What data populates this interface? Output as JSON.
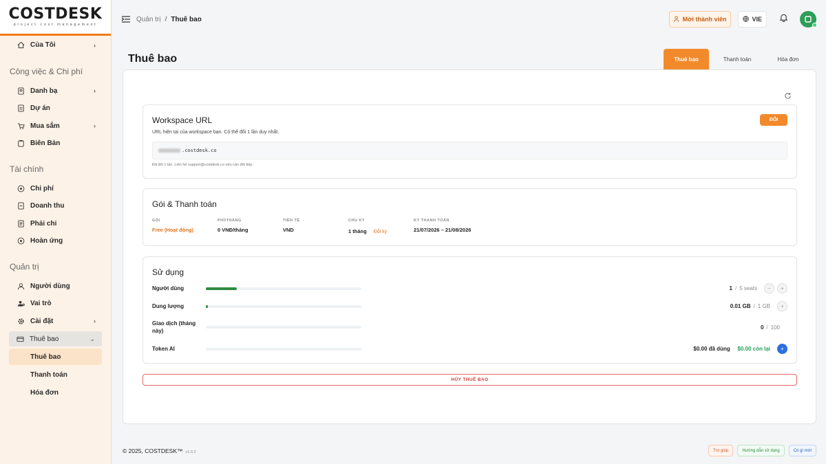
{
  "logo": {
    "name": "COSTDESK",
    "tagline": "project cost management"
  },
  "sidebar": {
    "top_item": {
      "label": "Của Tôi"
    },
    "sections": [
      {
        "title": "Công việc & Chi phí",
        "items": [
          {
            "label": "Danh bạ",
            "chevron": true
          },
          {
            "label": "Dự án",
            "chevron": false
          },
          {
            "label": "Mua sắm",
            "chevron": true
          },
          {
            "label": "Biên Bản",
            "chevron": false
          }
        ]
      },
      {
        "title": "Tài chính",
        "items": [
          {
            "label": "Chi phí"
          },
          {
            "label": "Doanh thu"
          },
          {
            "label": "Phải chi"
          },
          {
            "label": "Hoàn ứng"
          }
        ]
      },
      {
        "title": "Quản trị",
        "items": [
          {
            "label": "Người dùng"
          },
          {
            "label": "Vai trò"
          },
          {
            "label": "Cài đặt"
          },
          {
            "label": "Thuê bao"
          }
        ]
      }
    ],
    "sub_items": [
      {
        "label": "Thuê bao",
        "active": true
      },
      {
        "label": "Thanh toán",
        "active": false
      },
      {
        "label": "Hóa đơn",
        "active": false
      }
    ]
  },
  "header": {
    "breadcrumb_parent": "Quản trị",
    "breadcrumb_sep": "/",
    "breadcrumb_current": "Thuê bao",
    "invite_label": "Mời thành viên",
    "lang_label": "VIE"
  },
  "page": {
    "title": "Thuê bao",
    "tabs": [
      {
        "label": "Thuê bao"
      },
      {
        "label": "Thanh toán"
      },
      {
        "label": "Hóa đơn"
      }
    ]
  },
  "workspace": {
    "title": "Workspace URL",
    "description": "URL hiện tại của workspace bạn. Có thể đổi 1 lần duy nhất.",
    "change_label": "ĐỔI",
    "url_suffix": ".costdesk.co",
    "note": "Đã đổi 1 lần. Liên hệ support@costdesk.co nếu cần đổi tiếp."
  },
  "plan": {
    "title": "Gói & Thanh toán",
    "cols": [
      {
        "label": "GÓI",
        "value": "Free (Hoạt động)"
      },
      {
        "label": "PHÍ/THÁNG",
        "value": "0 VNĐ/tháng"
      },
      {
        "label": "TIỀN TỆ",
        "value": "VND"
      },
      {
        "label": "CHU KỲ",
        "value": "1 tháng",
        "action": "Đổi kỳ"
      },
      {
        "label": "KỲ THANH TOÁN",
        "value": "21/07/2026 – 21/08/2026"
      }
    ]
  },
  "usage": {
    "title": "Sử dụng",
    "rows": [
      {
        "label": "Người dùng",
        "used": "1",
        "sep": "/",
        "limit": "5 seats",
        "fill": 0.2
      },
      {
        "label": "Dung lượng",
        "used": "0.01 GB",
        "sep": "/",
        "limit": "1 GB",
        "fill": 0.01
      },
      {
        "label": "Giao dịch (tháng này)",
        "used": "0",
        "sep": "/",
        "limit": "100",
        "fill": 0
      },
      {
        "label": "Token AI",
        "used": "$0.00 đã dùng",
        "sep": "·",
        "limit": "$0.00 còn lại",
        "fill": 0
      }
    ]
  },
  "cancel_label": "HỦY THUÊ BAO",
  "footer": {
    "copyright": "© 2025, COSTDESK™",
    "version": "v1.0.2",
    "buttons": [
      {
        "label": "Trợ giúp"
      },
      {
        "label": "Hướng dẫn sử dụng"
      },
      {
        "label": "Có gì mới"
      }
    ]
  },
  "colors": {
    "accent": "#f28a2b",
    "danger": "#d33a3a",
    "progress": "#2e8b3e",
    "primary_blue": "#2c6fe0"
  }
}
